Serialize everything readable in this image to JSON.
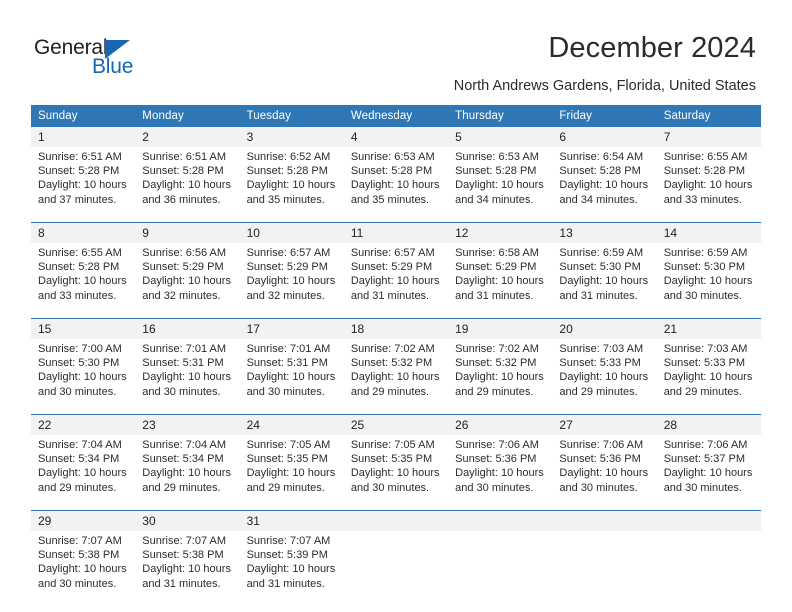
{
  "brand": {
    "name_part1": "General",
    "name_part2": "Blue",
    "logo_icon": "triangle-icon"
  },
  "header": {
    "title": "December 2024",
    "subtitle": "North Andrews Gardens, Florida, United States"
  },
  "colors": {
    "header_blue": "#3077b6",
    "brand_blue": "#1668b3",
    "date_band": "#f2f2f2",
    "text": "#2c2c2c"
  },
  "weekdays": [
    "Sunday",
    "Monday",
    "Tuesday",
    "Wednesday",
    "Thursday",
    "Friday",
    "Saturday"
  ],
  "weeks": [
    {
      "days": [
        {
          "date": "1",
          "sunrise": "Sunrise: 6:51 AM",
          "sunset": "Sunset: 5:28 PM",
          "daylight1": "Daylight: 10 hours",
          "daylight2": "and 37 minutes."
        },
        {
          "date": "2",
          "sunrise": "Sunrise: 6:51 AM",
          "sunset": "Sunset: 5:28 PM",
          "daylight1": "Daylight: 10 hours",
          "daylight2": "and 36 minutes."
        },
        {
          "date": "3",
          "sunrise": "Sunrise: 6:52 AM",
          "sunset": "Sunset: 5:28 PM",
          "daylight1": "Daylight: 10 hours",
          "daylight2": "and 35 minutes."
        },
        {
          "date": "4",
          "sunrise": "Sunrise: 6:53 AM",
          "sunset": "Sunset: 5:28 PM",
          "daylight1": "Daylight: 10 hours",
          "daylight2": "and 35 minutes."
        },
        {
          "date": "5",
          "sunrise": "Sunrise: 6:53 AM",
          "sunset": "Sunset: 5:28 PM",
          "daylight1": "Daylight: 10 hours",
          "daylight2": "and 34 minutes."
        },
        {
          "date": "6",
          "sunrise": "Sunrise: 6:54 AM",
          "sunset": "Sunset: 5:28 PM",
          "daylight1": "Daylight: 10 hours",
          "daylight2": "and 34 minutes."
        },
        {
          "date": "7",
          "sunrise": "Sunrise: 6:55 AM",
          "sunset": "Sunset: 5:28 PM",
          "daylight1": "Daylight: 10 hours",
          "daylight2": "and 33 minutes."
        }
      ]
    },
    {
      "days": [
        {
          "date": "8",
          "sunrise": "Sunrise: 6:55 AM",
          "sunset": "Sunset: 5:28 PM",
          "daylight1": "Daylight: 10 hours",
          "daylight2": "and 33 minutes."
        },
        {
          "date": "9",
          "sunrise": "Sunrise: 6:56 AM",
          "sunset": "Sunset: 5:29 PM",
          "daylight1": "Daylight: 10 hours",
          "daylight2": "and 32 minutes."
        },
        {
          "date": "10",
          "sunrise": "Sunrise: 6:57 AM",
          "sunset": "Sunset: 5:29 PM",
          "daylight1": "Daylight: 10 hours",
          "daylight2": "and 32 minutes."
        },
        {
          "date": "11",
          "sunrise": "Sunrise: 6:57 AM",
          "sunset": "Sunset: 5:29 PM",
          "daylight1": "Daylight: 10 hours",
          "daylight2": "and 31 minutes."
        },
        {
          "date": "12",
          "sunrise": "Sunrise: 6:58 AM",
          "sunset": "Sunset: 5:29 PM",
          "daylight1": "Daylight: 10 hours",
          "daylight2": "and 31 minutes."
        },
        {
          "date": "13",
          "sunrise": "Sunrise: 6:59 AM",
          "sunset": "Sunset: 5:30 PM",
          "daylight1": "Daylight: 10 hours",
          "daylight2": "and 31 minutes."
        },
        {
          "date": "14",
          "sunrise": "Sunrise: 6:59 AM",
          "sunset": "Sunset: 5:30 PM",
          "daylight1": "Daylight: 10 hours",
          "daylight2": "and 30 minutes."
        }
      ]
    },
    {
      "days": [
        {
          "date": "15",
          "sunrise": "Sunrise: 7:00 AM",
          "sunset": "Sunset: 5:30 PM",
          "daylight1": "Daylight: 10 hours",
          "daylight2": "and 30 minutes."
        },
        {
          "date": "16",
          "sunrise": "Sunrise: 7:01 AM",
          "sunset": "Sunset: 5:31 PM",
          "daylight1": "Daylight: 10 hours",
          "daylight2": "and 30 minutes."
        },
        {
          "date": "17",
          "sunrise": "Sunrise: 7:01 AM",
          "sunset": "Sunset: 5:31 PM",
          "daylight1": "Daylight: 10 hours",
          "daylight2": "and 30 minutes."
        },
        {
          "date": "18",
          "sunrise": "Sunrise: 7:02 AM",
          "sunset": "Sunset: 5:32 PM",
          "daylight1": "Daylight: 10 hours",
          "daylight2": "and 29 minutes."
        },
        {
          "date": "19",
          "sunrise": "Sunrise: 7:02 AM",
          "sunset": "Sunset: 5:32 PM",
          "daylight1": "Daylight: 10 hours",
          "daylight2": "and 29 minutes."
        },
        {
          "date": "20",
          "sunrise": "Sunrise: 7:03 AM",
          "sunset": "Sunset: 5:33 PM",
          "daylight1": "Daylight: 10 hours",
          "daylight2": "and 29 minutes."
        },
        {
          "date": "21",
          "sunrise": "Sunrise: 7:03 AM",
          "sunset": "Sunset: 5:33 PM",
          "daylight1": "Daylight: 10 hours",
          "daylight2": "and 29 minutes."
        }
      ]
    },
    {
      "days": [
        {
          "date": "22",
          "sunrise": "Sunrise: 7:04 AM",
          "sunset": "Sunset: 5:34 PM",
          "daylight1": "Daylight: 10 hours",
          "daylight2": "and 29 minutes."
        },
        {
          "date": "23",
          "sunrise": "Sunrise: 7:04 AM",
          "sunset": "Sunset: 5:34 PM",
          "daylight1": "Daylight: 10 hours",
          "daylight2": "and 29 minutes."
        },
        {
          "date": "24",
          "sunrise": "Sunrise: 7:05 AM",
          "sunset": "Sunset: 5:35 PM",
          "daylight1": "Daylight: 10 hours",
          "daylight2": "and 29 minutes."
        },
        {
          "date": "25",
          "sunrise": "Sunrise: 7:05 AM",
          "sunset": "Sunset: 5:35 PM",
          "daylight1": "Daylight: 10 hours",
          "daylight2": "and 30 minutes."
        },
        {
          "date": "26",
          "sunrise": "Sunrise: 7:06 AM",
          "sunset": "Sunset: 5:36 PM",
          "daylight1": "Daylight: 10 hours",
          "daylight2": "and 30 minutes."
        },
        {
          "date": "27",
          "sunrise": "Sunrise: 7:06 AM",
          "sunset": "Sunset: 5:36 PM",
          "daylight1": "Daylight: 10 hours",
          "daylight2": "and 30 minutes."
        },
        {
          "date": "28",
          "sunrise": "Sunrise: 7:06 AM",
          "sunset": "Sunset: 5:37 PM",
          "daylight1": "Daylight: 10 hours",
          "daylight2": "and 30 minutes."
        }
      ]
    },
    {
      "days": [
        {
          "date": "29",
          "sunrise": "Sunrise: 7:07 AM",
          "sunset": "Sunset: 5:38 PM",
          "daylight1": "Daylight: 10 hours",
          "daylight2": "and 30 minutes."
        },
        {
          "date": "30",
          "sunrise": "Sunrise: 7:07 AM",
          "sunset": "Sunset: 5:38 PM",
          "daylight1": "Daylight: 10 hours",
          "daylight2": "and 31 minutes."
        },
        {
          "date": "31",
          "sunrise": "Sunrise: 7:07 AM",
          "sunset": "Sunset: 5:39 PM",
          "daylight1": "Daylight: 10 hours",
          "daylight2": "and 31 minutes."
        },
        {
          "date": "",
          "sunrise": "",
          "sunset": "",
          "daylight1": "",
          "daylight2": ""
        },
        {
          "date": "",
          "sunrise": "",
          "sunset": "",
          "daylight1": "",
          "daylight2": ""
        },
        {
          "date": "",
          "sunrise": "",
          "sunset": "",
          "daylight1": "",
          "daylight2": ""
        },
        {
          "date": "",
          "sunrise": "",
          "sunset": "",
          "daylight1": "",
          "daylight2": ""
        }
      ]
    }
  ]
}
